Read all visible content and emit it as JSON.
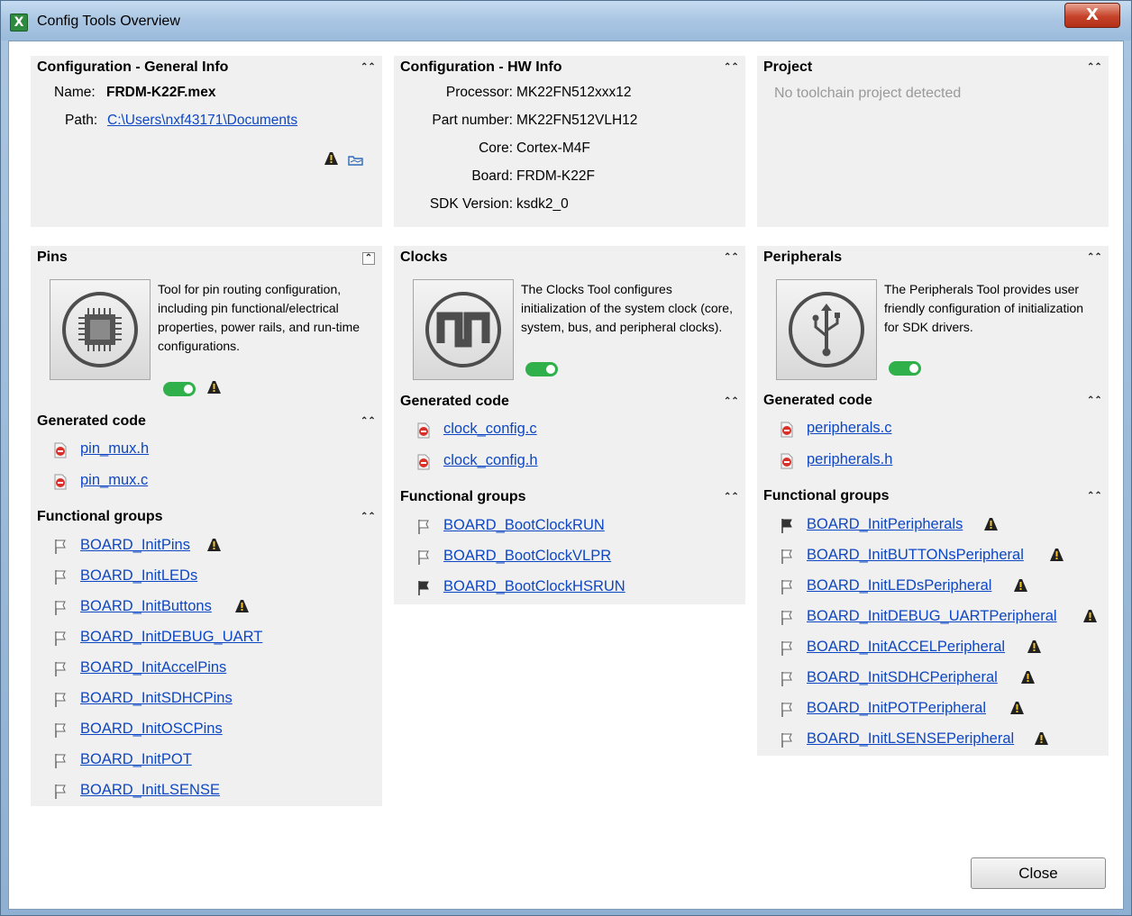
{
  "window": {
    "title": "Config Tools Overview",
    "close_glyph": "X"
  },
  "general": {
    "title": "Configuration - General Info",
    "name_label": "Name:",
    "name_value": "FRDM-K22F.mex",
    "path_label": "Path:",
    "path_value": "C:\\Users\\nxf43171\\Documents"
  },
  "hw": {
    "title": "Configuration - HW Info",
    "rows": [
      {
        "k": "Processor:",
        "v": "MK22FN512xxx12"
      },
      {
        "k": "Part number:",
        "v": "MK22FN512VLH12"
      },
      {
        "k": "Core:",
        "v": "Cortex-M4F"
      },
      {
        "k": "Board:",
        "v": "FRDM-K22F"
      },
      {
        "k": "SDK Version:",
        "v": "ksdk2_0"
      }
    ]
  },
  "project": {
    "title": "Project",
    "status": "No toolchain project detected"
  },
  "pins": {
    "title": "Pins",
    "description": "Tool for pin routing configuration, including pin functional/electrical properties, power rails, and run-time configurations.",
    "generated_code_title": "Generated code",
    "files": [
      "pin_mux.h",
      "pin_mux.c"
    ],
    "functional_groups_title": "Functional groups",
    "groups": [
      "BOARD_InitPins",
      "BOARD_InitLEDs",
      "BOARD_InitButtons",
      "BOARD_InitDEBUG_UART",
      "BOARD_InitAccelPins",
      "BOARD_InitSDHCPins",
      "BOARD_InitOSCPins",
      "BOARD_InitPOT",
      "BOARD_InitLSENSE"
    ]
  },
  "clocks": {
    "title": "Clocks",
    "description": "The Clocks Tool configures initialization of the system clock (core, system, bus, and peripheral clocks).",
    "generated_code_title": "Generated code",
    "files": [
      "clock_config.c",
      "clock_config.h"
    ],
    "functional_groups_title": "Functional groups",
    "groups": [
      "BOARD_BootClockRUN",
      "BOARD_BootClockVLPR",
      "BOARD_BootClockHSRUN"
    ]
  },
  "peripherals": {
    "title": "Peripherals",
    "description": "The Peripherals Tool provides user friendly configuration of initialization for SDK drivers.",
    "generated_code_title": "Generated code",
    "files": [
      "peripherals.c",
      "peripherals.h"
    ],
    "functional_groups_title": "Functional groups",
    "groups": [
      "BOARD_InitPeripherals",
      "BOARD_InitBUTTONsPeripheral",
      "BOARD_InitLEDsPeripheral",
      "BOARD_InitDEBUG_UARTPeripheral",
      "BOARD_InitACCELPeripheral",
      "BOARD_InitSDHCPeripheral",
      "BOARD_InitPOTPeripheral",
      "BOARD_InitLSENSEPeripheral"
    ]
  },
  "buttons": {
    "close": "Close"
  },
  "colors": {
    "link": "#0e47c4",
    "toggle_on": "#2fb04a",
    "panel_bg": "#f0f0f0"
  }
}
